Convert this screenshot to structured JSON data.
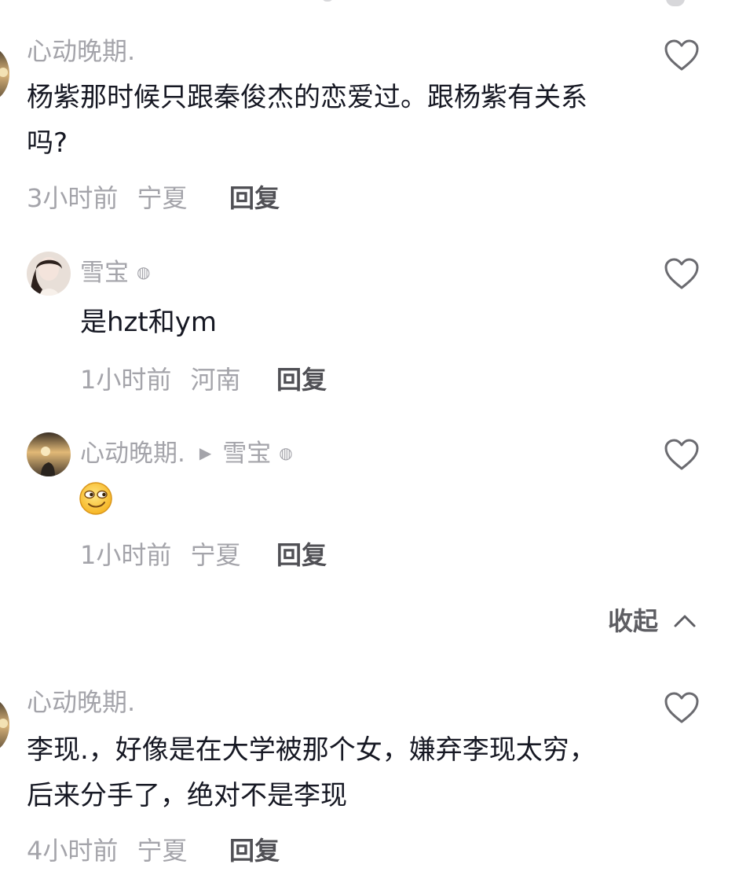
{
  "comments": [
    {
      "username": "心动晚期.",
      "text": "杨紫那时候只跟秦俊杰的恋爱过。跟杨紫有关系吗?",
      "time": "3小时前",
      "location": "宁夏",
      "reply_label": "回复",
      "replies": [
        {
          "username": "雪宝",
          "vip_badge": "◍",
          "text": "是hzt和ym",
          "time": "1小时前",
          "location": "河南",
          "reply_label": "回复"
        },
        {
          "username": "心动晚期.",
          "reply_to_arrow": "▶",
          "reply_to": "雪宝",
          "vip_badge": "◍",
          "text_emoji": "smirk-emoji",
          "time": "1小时前",
          "location": "宁夏",
          "reply_label": "回复"
        }
      ],
      "collapse_label": "收起",
      "collapse_icon": "chevron-up-icon"
    },
    {
      "username": "心动晚期.",
      "text": "李现.，好像是在大学被那个女，嫌弃李现太穷，后来分手了，绝对不是李现",
      "time": "4小时前",
      "location": "宁夏",
      "reply_label": "回复"
    }
  ],
  "colors": {
    "secondary_text": "#a4a4aa",
    "primary_text": "#161823",
    "reply_button": "#505055"
  }
}
